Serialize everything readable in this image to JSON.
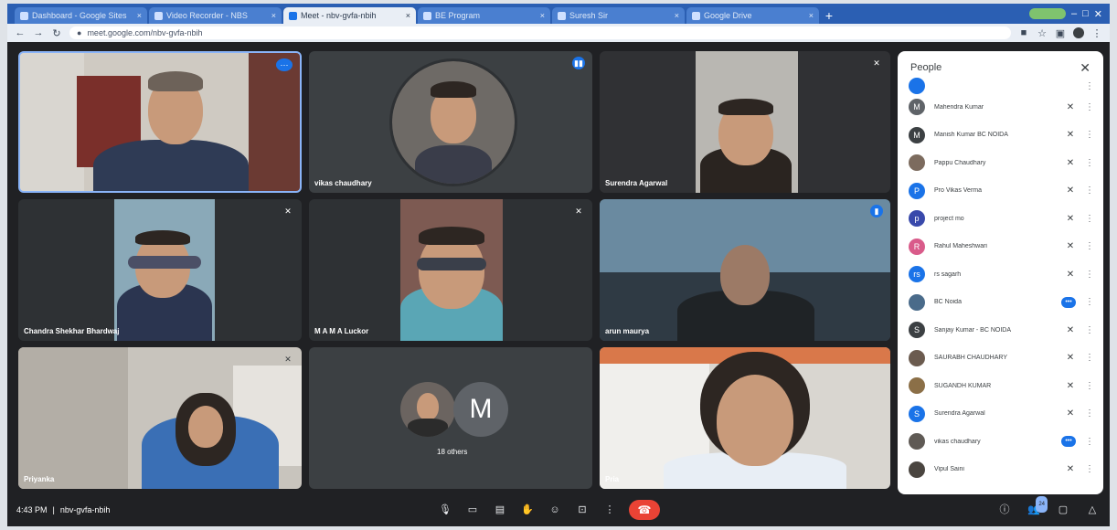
{
  "browser": {
    "tabs": [
      {
        "label": "Dashboard - Google Sites"
      },
      {
        "label": "Video Recorder - NBS"
      },
      {
        "label": "Meet - nbv-gvfa-nbih",
        "active": true
      },
      {
        "label": "BE Program"
      },
      {
        "label": "Suresh Sir"
      },
      {
        "label": "Google Drive"
      }
    ],
    "url": "meet.google.com/nbv-gvfa-nbih"
  },
  "tiles": {
    "t1": {
      "name": ""
    },
    "t2": {
      "name": "vikas chaudhary"
    },
    "t3": {
      "name": "Surendra Agarwal"
    },
    "t4": {
      "name": "Chandra Shekhar Bhardwaj"
    },
    "t5": {
      "name": "M A M A Luckor"
    },
    "t6": {
      "name": "arun maurya"
    },
    "t7": {
      "name": "Priyanka"
    },
    "t8": {
      "others": "18 others",
      "avatar_letter": "M"
    },
    "t9": {
      "name": "Pria"
    }
  },
  "people": {
    "title": "People",
    "close_symbol": "✕",
    "members": [
      {
        "name": "",
        "initial": "",
        "color": "#1a73e8",
        "partial": true
      },
      {
        "name": "Mahendra Kumar",
        "initial": "M",
        "color": "#5f6368"
      },
      {
        "name": "Manish Kumar BC NOIDA",
        "initial": "M",
        "color": "#3c4043"
      },
      {
        "name": "Pappu Chaudhary",
        "initial": "",
        "color": "#7c6b5e"
      },
      {
        "name": "Pro Vikas Verma",
        "initial": "P",
        "color": "#1a73e8"
      },
      {
        "name": "project mo",
        "initial": "p",
        "color": "#3949ab"
      },
      {
        "name": "Rahul Maheshwari",
        "initial": "R",
        "color": "#d95b8a"
      },
      {
        "name": "rs sagarh",
        "initial": "rs",
        "color": "#1a73e8"
      },
      {
        "name": "BC Noida",
        "initial": "",
        "color": "#4a6b8a",
        "mic": "talking"
      },
      {
        "name": "Sanjay Kumar - BC NOIDA",
        "initial": "S",
        "color": "#3c4043"
      },
      {
        "name": "SAURABH CHAUDHARY",
        "initial": "",
        "color": "#6b5b4f"
      },
      {
        "name": "SUGANDH KUMAR",
        "initial": "",
        "color": "#8b6f47"
      },
      {
        "name": "Surendra Agarwal",
        "initial": "S",
        "color": "#1a73e8"
      },
      {
        "name": "vikas chaudhary",
        "initial": "",
        "color": "#5f5a55",
        "mic": "talking"
      },
      {
        "name": "Vipul Saini",
        "initial": "",
        "color": "#4a4540"
      }
    ]
  },
  "bottombar": {
    "time": "4:43 PM",
    "meeting_code": "nbv-gvfa-nbih",
    "people_count": "24"
  }
}
